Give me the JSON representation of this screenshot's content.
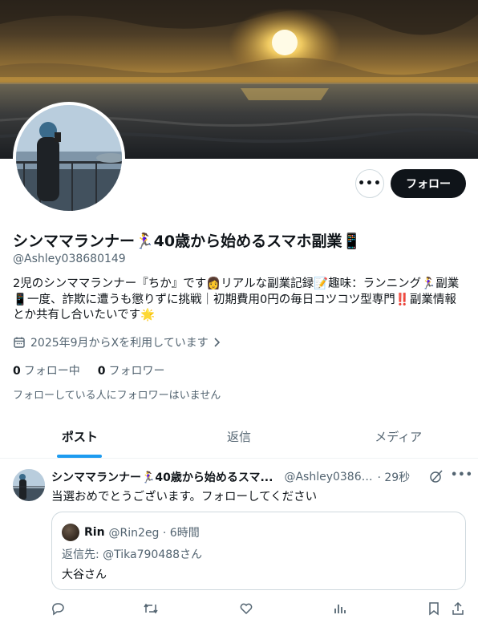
{
  "profile": {
    "display_name": "シンママランナー🏃‍♀️40歳から始めるスマホ副業📱",
    "handle": "@Ashley038680149",
    "bio": "2児のシンママランナー『ちか』です👩リアルな副業記録📝趣味：ランニング🏃‍♀️副業📱一度、詐欺に遭うも懲りずに挑戦｜初期費用0円の毎日コツコツ型専門‼️副業情報とか共有し合いたいです🌟",
    "joined": "2025年9月からXを利用しています",
    "following_count": "0",
    "following_label": "フォロー中",
    "followers_count": "0",
    "followers_label": "フォロワー",
    "no_followers_note": "フォローしている人にフォロワーはいません"
  },
  "buttons": {
    "more": "•••",
    "follow": "フォロー"
  },
  "tabs": [
    {
      "label": "ポスト",
      "active": true
    },
    {
      "label": "返信",
      "active": false
    },
    {
      "label": "メディア",
      "active": false
    }
  ],
  "tweet": {
    "name": "シンママランナー🏃‍♀️40歳から始めるスマ...",
    "handle": "@Ashley03868...",
    "time": "· 29秒",
    "text": "当選おめでとうございます。フォローしてください",
    "more": "•••",
    "quote": {
      "name": "Rin",
      "handle": "@Rin2eg · 6時間",
      "reply_to": "返信先: @Tika790488さん",
      "text": "大谷さん"
    }
  },
  "icons": {
    "calendar": "calendar-icon",
    "chevron": "chevron-right-icon",
    "grok": "grok-icon",
    "reply": "reply-icon",
    "retweet": "retweet-icon",
    "like": "like-icon",
    "views": "views-icon",
    "bookmark": "bookmark-icon",
    "share": "share-icon"
  },
  "colors": {
    "accent": "#1d9bf0",
    "text": "#0f1419",
    "secondary": "#536471",
    "follow_bg": "#0f1419"
  }
}
